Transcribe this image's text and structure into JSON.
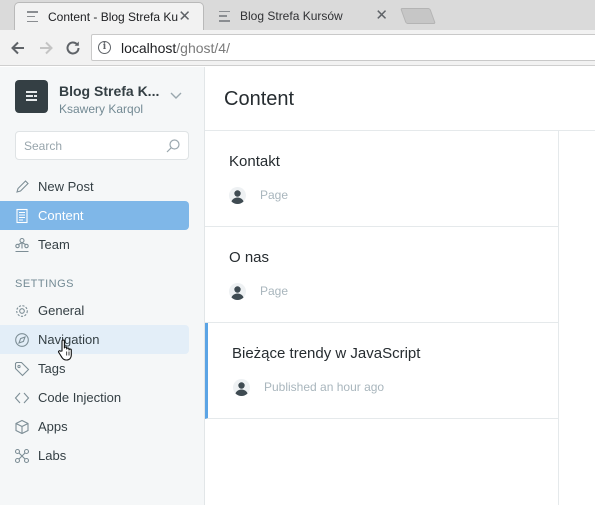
{
  "browser": {
    "tabs": [
      {
        "title": "Content - Blog Strefa Kursów",
        "active": true
      },
      {
        "title": "Blog Strefa Kursów",
        "active": false
      }
    ],
    "url_host": "localhost",
    "url_path": "/ghost/4/"
  },
  "blog": {
    "title": "Blog Strefa K...",
    "user": "Ksawery Karqol"
  },
  "search": {
    "placeholder": "Search"
  },
  "nav": {
    "primary": [
      {
        "label": "New Post",
        "icon": "pen-icon"
      },
      {
        "label": "Content",
        "icon": "document-icon",
        "active": true
      },
      {
        "label": "Team",
        "icon": "team-icon"
      }
    ],
    "settings_label": "SETTINGS",
    "settings": [
      {
        "label": "General",
        "icon": "gear-icon"
      },
      {
        "label": "Navigation",
        "icon": "compass-icon",
        "hover": true
      },
      {
        "label": "Tags",
        "icon": "tag-icon"
      },
      {
        "label": "Code Injection",
        "icon": "code-icon"
      },
      {
        "label": "Apps",
        "icon": "box-icon"
      },
      {
        "label": "Labs",
        "icon": "labs-icon"
      }
    ]
  },
  "main": {
    "title": "Content",
    "posts": [
      {
        "title": "Kontakt",
        "meta": "Page"
      },
      {
        "title": "O nas",
        "meta": "Page"
      },
      {
        "title": "Bieżące trendy w JavaScript",
        "meta": "Published an hour ago",
        "selected": true
      }
    ]
  },
  "colors": {
    "active_nav": "#7fb7e8",
    "hover_nav": "#e3eef8",
    "selected_border": "#5ba4e5",
    "sidebar_bg": "#f5f7f8"
  }
}
